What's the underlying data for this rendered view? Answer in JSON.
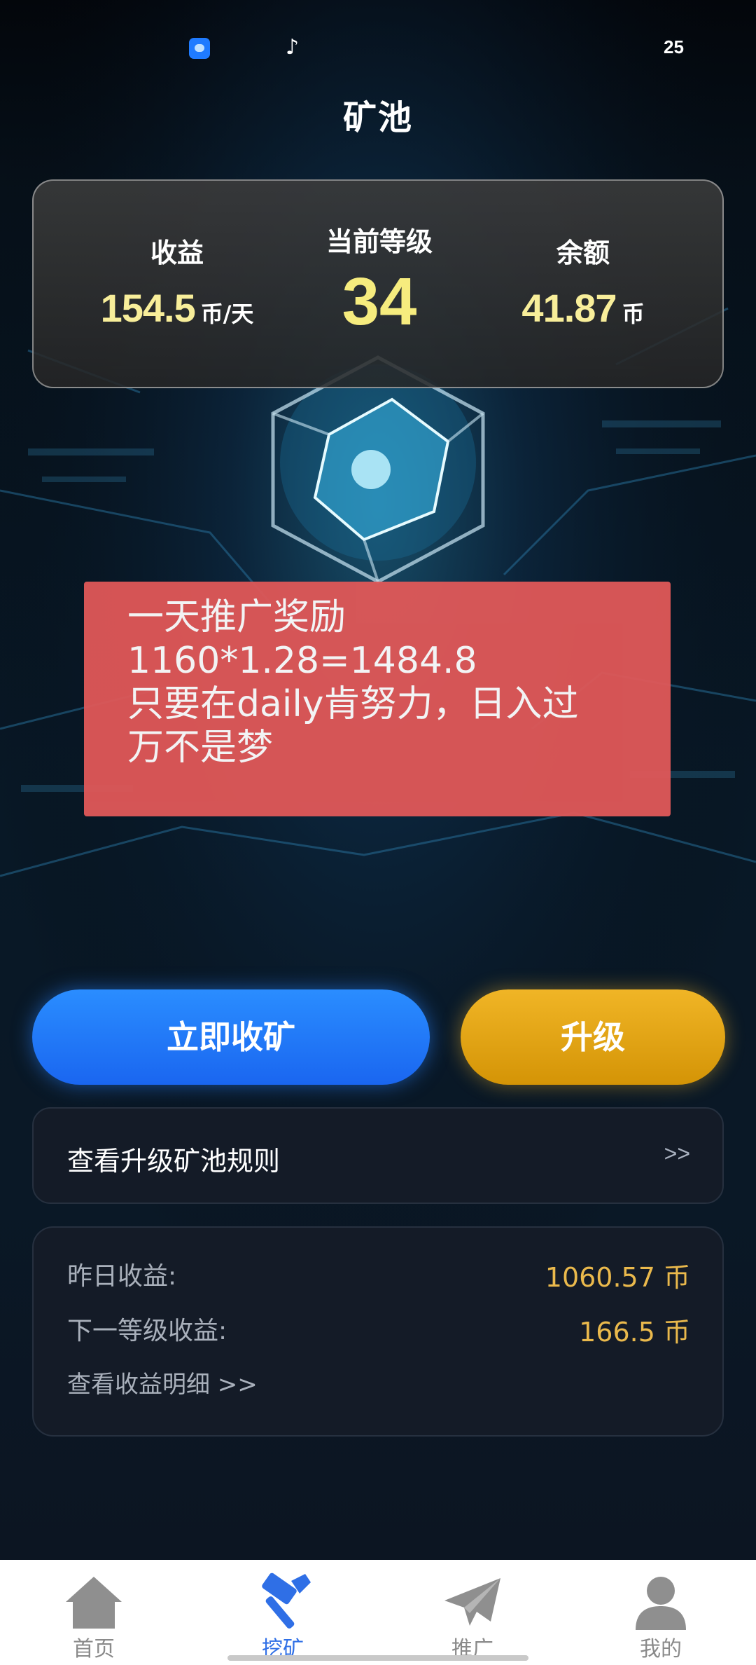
{
  "status_bar": {
    "app_icon": "chat-app-icon",
    "second_icon": "tiktok-icon",
    "tiktok_glyph": "♪",
    "battery_text": "25"
  },
  "header": {
    "title": "矿池"
  },
  "stats": {
    "income_label": "收益",
    "income_value": "154.5",
    "income_unit": "币/天",
    "level_label": "当前等级",
    "level_value": "34",
    "balance_label": "余额",
    "balance_value": "41.87",
    "balance_unit": "币"
  },
  "promo_note": {
    "lines": [
      "一天推广奖励",
      "1160*1.28=1484.8",
      "只要在daily肯努力，日入过",
      "万不是梦"
    ]
  },
  "actions": {
    "collect_label": "立即收矿",
    "upgrade_label": "升级"
  },
  "rules": {
    "label": "查看升级矿池规则",
    "chevron": ">>"
  },
  "earnings": {
    "yesterday_label": "昨日收益:",
    "yesterday_value": "1060.57 币",
    "next_level_label": "下一等级收益:",
    "next_level_value": "166.5 币",
    "detail_link": "查看收益明细 >>"
  },
  "bottom_nav": {
    "items": [
      {
        "label": "首页",
        "icon": "home-icon"
      },
      {
        "label": "挖矿",
        "icon": "hammer-icon",
        "active": true
      },
      {
        "label": "推广",
        "icon": "paper-plane-icon"
      },
      {
        "label": "我的",
        "icon": "person-icon"
      }
    ]
  },
  "colors": {
    "accent_blue": "#2a8dff",
    "accent_gold": "#f0b526",
    "value_yellow": "#f8ee9a",
    "promo_red": "#e05858",
    "earnings_gold": "#eab94c",
    "nav_active": "#2f6fe6"
  }
}
